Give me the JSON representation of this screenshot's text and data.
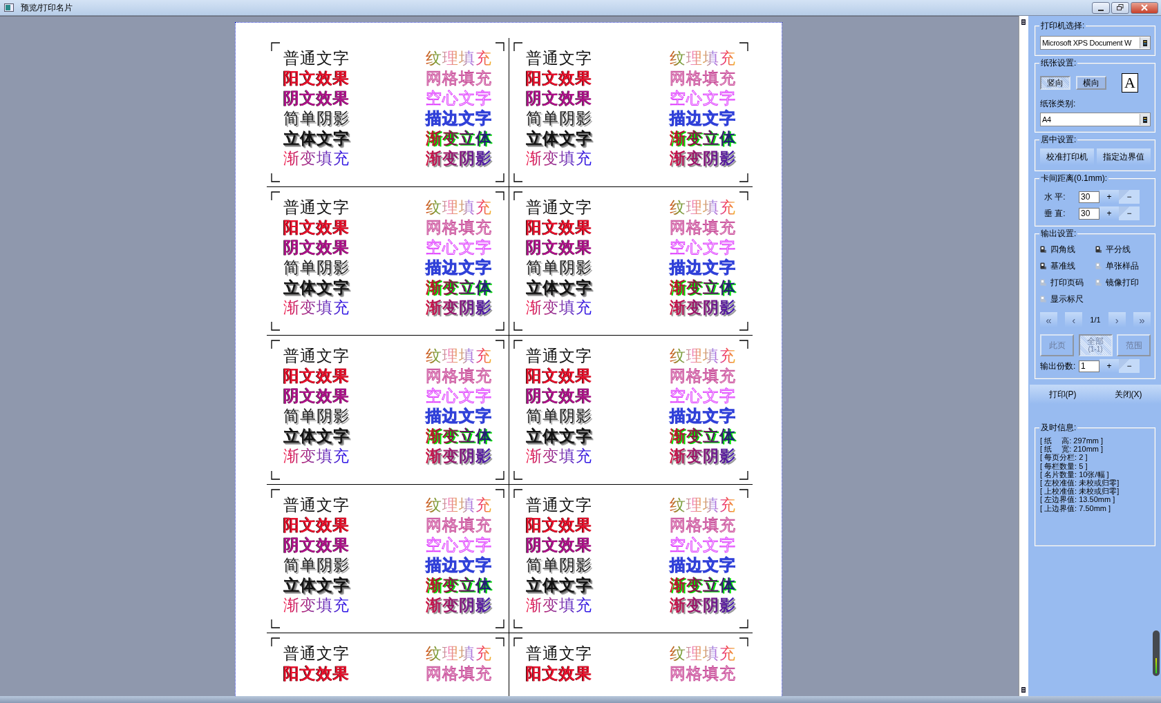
{
  "window": {
    "title": "预览/打印名片"
  },
  "cards": [
    {
      "left": [
        {
          "text": "普通文字",
          "kind": "plain"
        },
        {
          "text": "阳文效果",
          "kind": "emboss"
        },
        {
          "text": "阴文效果",
          "kind": "engrave"
        },
        {
          "text": "简单阴影",
          "kind": "shadow"
        },
        {
          "text": "立体文字",
          "kind": "solid"
        },
        {
          "text": "渐变填充",
          "kind": "gradient"
        }
      ],
      "right": [
        {
          "text": "纹理填充",
          "kind": "texture"
        },
        {
          "text": "网格填充",
          "kind": "grid"
        },
        {
          "text": "空心文字",
          "kind": "hollow"
        },
        {
          "text": "描边文字",
          "kind": "outline"
        },
        {
          "text": "渐变立体",
          "kind": "gradient-solid"
        },
        {
          "text": "渐变阴影",
          "kind": "gradient-shadow"
        }
      ]
    },
    {
      "left": [
        {
          "text": "普通文字",
          "kind": "plain"
        },
        {
          "text": "阳文效果",
          "kind": "emboss"
        },
        {
          "text": "阴文效果",
          "kind": "engrave"
        },
        {
          "text": "简单阴影",
          "kind": "shadow"
        },
        {
          "text": "立体文字",
          "kind": "solid"
        },
        {
          "text": "渐变填充",
          "kind": "gradient"
        }
      ],
      "right": [
        {
          "text": "纹理填充",
          "kind": "texture"
        },
        {
          "text": "网格填充",
          "kind": "grid"
        },
        {
          "text": "空心文字",
          "kind": "hollow"
        },
        {
          "text": "描边文字",
          "kind": "outline"
        },
        {
          "text": "渐变立体",
          "kind": "gradient-solid"
        },
        {
          "text": "渐变阴影",
          "kind": "gradient-shadow"
        }
      ]
    },
    {
      "left": [
        {
          "text": "普通文字",
          "kind": "plain"
        },
        {
          "text": "阳文效果",
          "kind": "emboss"
        },
        {
          "text": "阴文效果",
          "kind": "engrave"
        },
        {
          "text": "简单阴影",
          "kind": "shadow"
        },
        {
          "text": "立体文字",
          "kind": "solid"
        },
        {
          "text": "渐变填充",
          "kind": "gradient"
        }
      ],
      "right": [
        {
          "text": "纹理填充",
          "kind": "texture"
        },
        {
          "text": "网格填充",
          "kind": "grid"
        },
        {
          "text": "空心文字",
          "kind": "hollow"
        },
        {
          "text": "描边文字",
          "kind": "outline"
        },
        {
          "text": "渐变立体",
          "kind": "gradient-solid"
        },
        {
          "text": "渐变阴影",
          "kind": "gradient-shadow"
        }
      ]
    },
    {
      "left": [
        {
          "text": "普通文字",
          "kind": "plain"
        },
        {
          "text": "阳文效果",
          "kind": "emboss"
        },
        {
          "text": "阴文效果",
          "kind": "engrave"
        },
        {
          "text": "简单阴影",
          "kind": "shadow"
        },
        {
          "text": "立体文字",
          "kind": "solid"
        },
        {
          "text": "渐变填充",
          "kind": "gradient"
        }
      ],
      "right": [
        {
          "text": "纹理填充",
          "kind": "texture"
        },
        {
          "text": "网格填充",
          "kind": "grid"
        },
        {
          "text": "空心文字",
          "kind": "hollow"
        },
        {
          "text": "描边文字",
          "kind": "outline"
        },
        {
          "text": "渐变立体",
          "kind": "gradient-solid"
        },
        {
          "text": "渐变阴影",
          "kind": "gradient-shadow"
        }
      ]
    },
    {
      "left": [
        {
          "text": "普通文字",
          "kind": "plain"
        },
        {
          "text": "阳文效果",
          "kind": "emboss"
        },
        {
          "text": "阴文效果",
          "kind": "engrave"
        },
        {
          "text": "简单阴影",
          "kind": "shadow"
        },
        {
          "text": "立体文字",
          "kind": "solid"
        },
        {
          "text": "渐变填充",
          "kind": "gradient"
        }
      ],
      "right": [
        {
          "text": "纹理填充",
          "kind": "texture"
        },
        {
          "text": "网格填充",
          "kind": "grid"
        },
        {
          "text": "空心文字",
          "kind": "hollow"
        },
        {
          "text": "描边文字",
          "kind": "outline"
        },
        {
          "text": "渐变立体",
          "kind": "gradient-solid"
        },
        {
          "text": "渐变阴影",
          "kind": "gradient-shadow"
        }
      ]
    },
    {
      "left": [
        {
          "text": "普通文字",
          "kind": "plain"
        },
        {
          "text": "阳文效果",
          "kind": "emboss"
        },
        {
          "text": "阴文效果",
          "kind": "engrave"
        },
        {
          "text": "简单阴影",
          "kind": "shadow"
        },
        {
          "text": "立体文字",
          "kind": "solid"
        },
        {
          "text": "渐变填充",
          "kind": "gradient"
        }
      ],
      "right": [
        {
          "text": "纹理填充",
          "kind": "texture"
        },
        {
          "text": "网格填充",
          "kind": "grid"
        },
        {
          "text": "空心文字",
          "kind": "hollow"
        },
        {
          "text": "描边文字",
          "kind": "outline"
        },
        {
          "text": "渐变立体",
          "kind": "gradient-solid"
        },
        {
          "text": "渐变阴影",
          "kind": "gradient-shadow"
        }
      ]
    },
    {
      "left": [
        {
          "text": "普通文字",
          "kind": "plain"
        },
        {
          "text": "阳文效果",
          "kind": "emboss"
        },
        {
          "text": "阴文效果",
          "kind": "engrave"
        },
        {
          "text": "简单阴影",
          "kind": "shadow"
        },
        {
          "text": "立体文字",
          "kind": "solid"
        },
        {
          "text": "渐变填充",
          "kind": "gradient"
        }
      ],
      "right": [
        {
          "text": "纹理填充",
          "kind": "texture"
        },
        {
          "text": "网格填充",
          "kind": "grid"
        },
        {
          "text": "空心文字",
          "kind": "hollow"
        },
        {
          "text": "描边文字",
          "kind": "outline"
        },
        {
          "text": "渐变立体",
          "kind": "gradient-solid"
        },
        {
          "text": "渐变阴影",
          "kind": "gradient-shadow"
        }
      ]
    },
    {
      "left": [
        {
          "text": "普通文字",
          "kind": "plain"
        },
        {
          "text": "阳文效果",
          "kind": "emboss"
        },
        {
          "text": "阴文效果",
          "kind": "engrave"
        },
        {
          "text": "简单阴影",
          "kind": "shadow"
        },
        {
          "text": "立体文字",
          "kind": "solid"
        },
        {
          "text": "渐变填充",
          "kind": "gradient"
        }
      ],
      "right": [
        {
          "text": "纹理填充",
          "kind": "texture"
        },
        {
          "text": "网格填充",
          "kind": "grid"
        },
        {
          "text": "空心文字",
          "kind": "hollow"
        },
        {
          "text": "描边文字",
          "kind": "outline"
        },
        {
          "text": "渐变立体",
          "kind": "gradient-solid"
        },
        {
          "text": "渐变阴影",
          "kind": "gradient-shadow"
        }
      ]
    },
    {
      "left": [
        {
          "text": "普通文字",
          "kind": "plain"
        },
        {
          "text": "阳文效果",
          "kind": "emboss"
        }
      ],
      "right": [
        {
          "text": "纹理填充",
          "kind": "texture"
        },
        {
          "text": "网格填充",
          "kind": "grid"
        }
      ]
    },
    {
      "left": [
        {
          "text": "普通文字",
          "kind": "plain"
        },
        {
          "text": "阳文效果",
          "kind": "emboss"
        }
      ],
      "right": [
        {
          "text": "纹理填充",
          "kind": "texture"
        },
        {
          "text": "网格填充",
          "kind": "grid"
        }
      ]
    }
  ],
  "panel": {
    "printer": {
      "label": "打印机选择:",
      "value": "Microsoft XPS Document W"
    },
    "paper": {
      "label": "纸张设置:",
      "orientations": [
        {
          "label": "竖向",
          "selected": true
        },
        {
          "label": "横向",
          "selected": false
        }
      ],
      "preview_letter": "A",
      "type_label": "纸张类别:",
      "type_value": "A4"
    },
    "centering": {
      "label": "居中设置:",
      "buttons": [
        "校准打印机",
        "指定边界值"
      ]
    },
    "spacing": {
      "label": "卡间距离(0.1mm):",
      "rows": [
        {
          "label": "水 平:",
          "value": "30",
          "plus": "+",
          "minus": "−"
        },
        {
          "label": "垂 直:",
          "value": "30",
          "plus": "+",
          "minus": "−"
        }
      ]
    },
    "output": {
      "label": "输出设置:",
      "options": [
        {
          "label": "四角线",
          "checked": true
        },
        {
          "label": "平分线",
          "checked": true
        },
        {
          "label": "基准线",
          "checked": true
        },
        {
          "label": "单张样品",
          "checked": false
        },
        {
          "label": "打印页码",
          "checked": false
        },
        {
          "label": "镜像打印",
          "checked": false
        },
        {
          "label": "显示标尺",
          "checked": false
        }
      ],
      "nav": {
        "first": "«",
        "prev": "‹",
        "page": "1/1",
        "next": "›",
        "last": "»"
      },
      "ranges": [
        {
          "label": "此页",
          "selected": false
        },
        {
          "label": "全部",
          "sub": "(1-1)",
          "selected": true
        },
        {
          "label": "范围",
          "selected": false
        }
      ],
      "copies": {
        "label": "输出份数:",
        "value": "1",
        "plus": "+",
        "minus": "−"
      }
    },
    "actions": [
      "打印(P)",
      "关闭(X)"
    ],
    "info": {
      "label": "及时信息:",
      "lines": [
        "[ 纸　 高: 297mm ]",
        "[ 纸　 宽: 210mm ]",
        "[ 每页分栏: 2 ]",
        "[ 每栏数量: 5 ]",
        "[ 名片数量: 10张/幅 ]",
        "[ 左校准值: 未校或归零]",
        "[ 上校准值: 未校或归零]",
        "[ 左边界值: 13.50mm ]",
        "[ 上边界值: 7.50mm ]"
      ]
    }
  }
}
